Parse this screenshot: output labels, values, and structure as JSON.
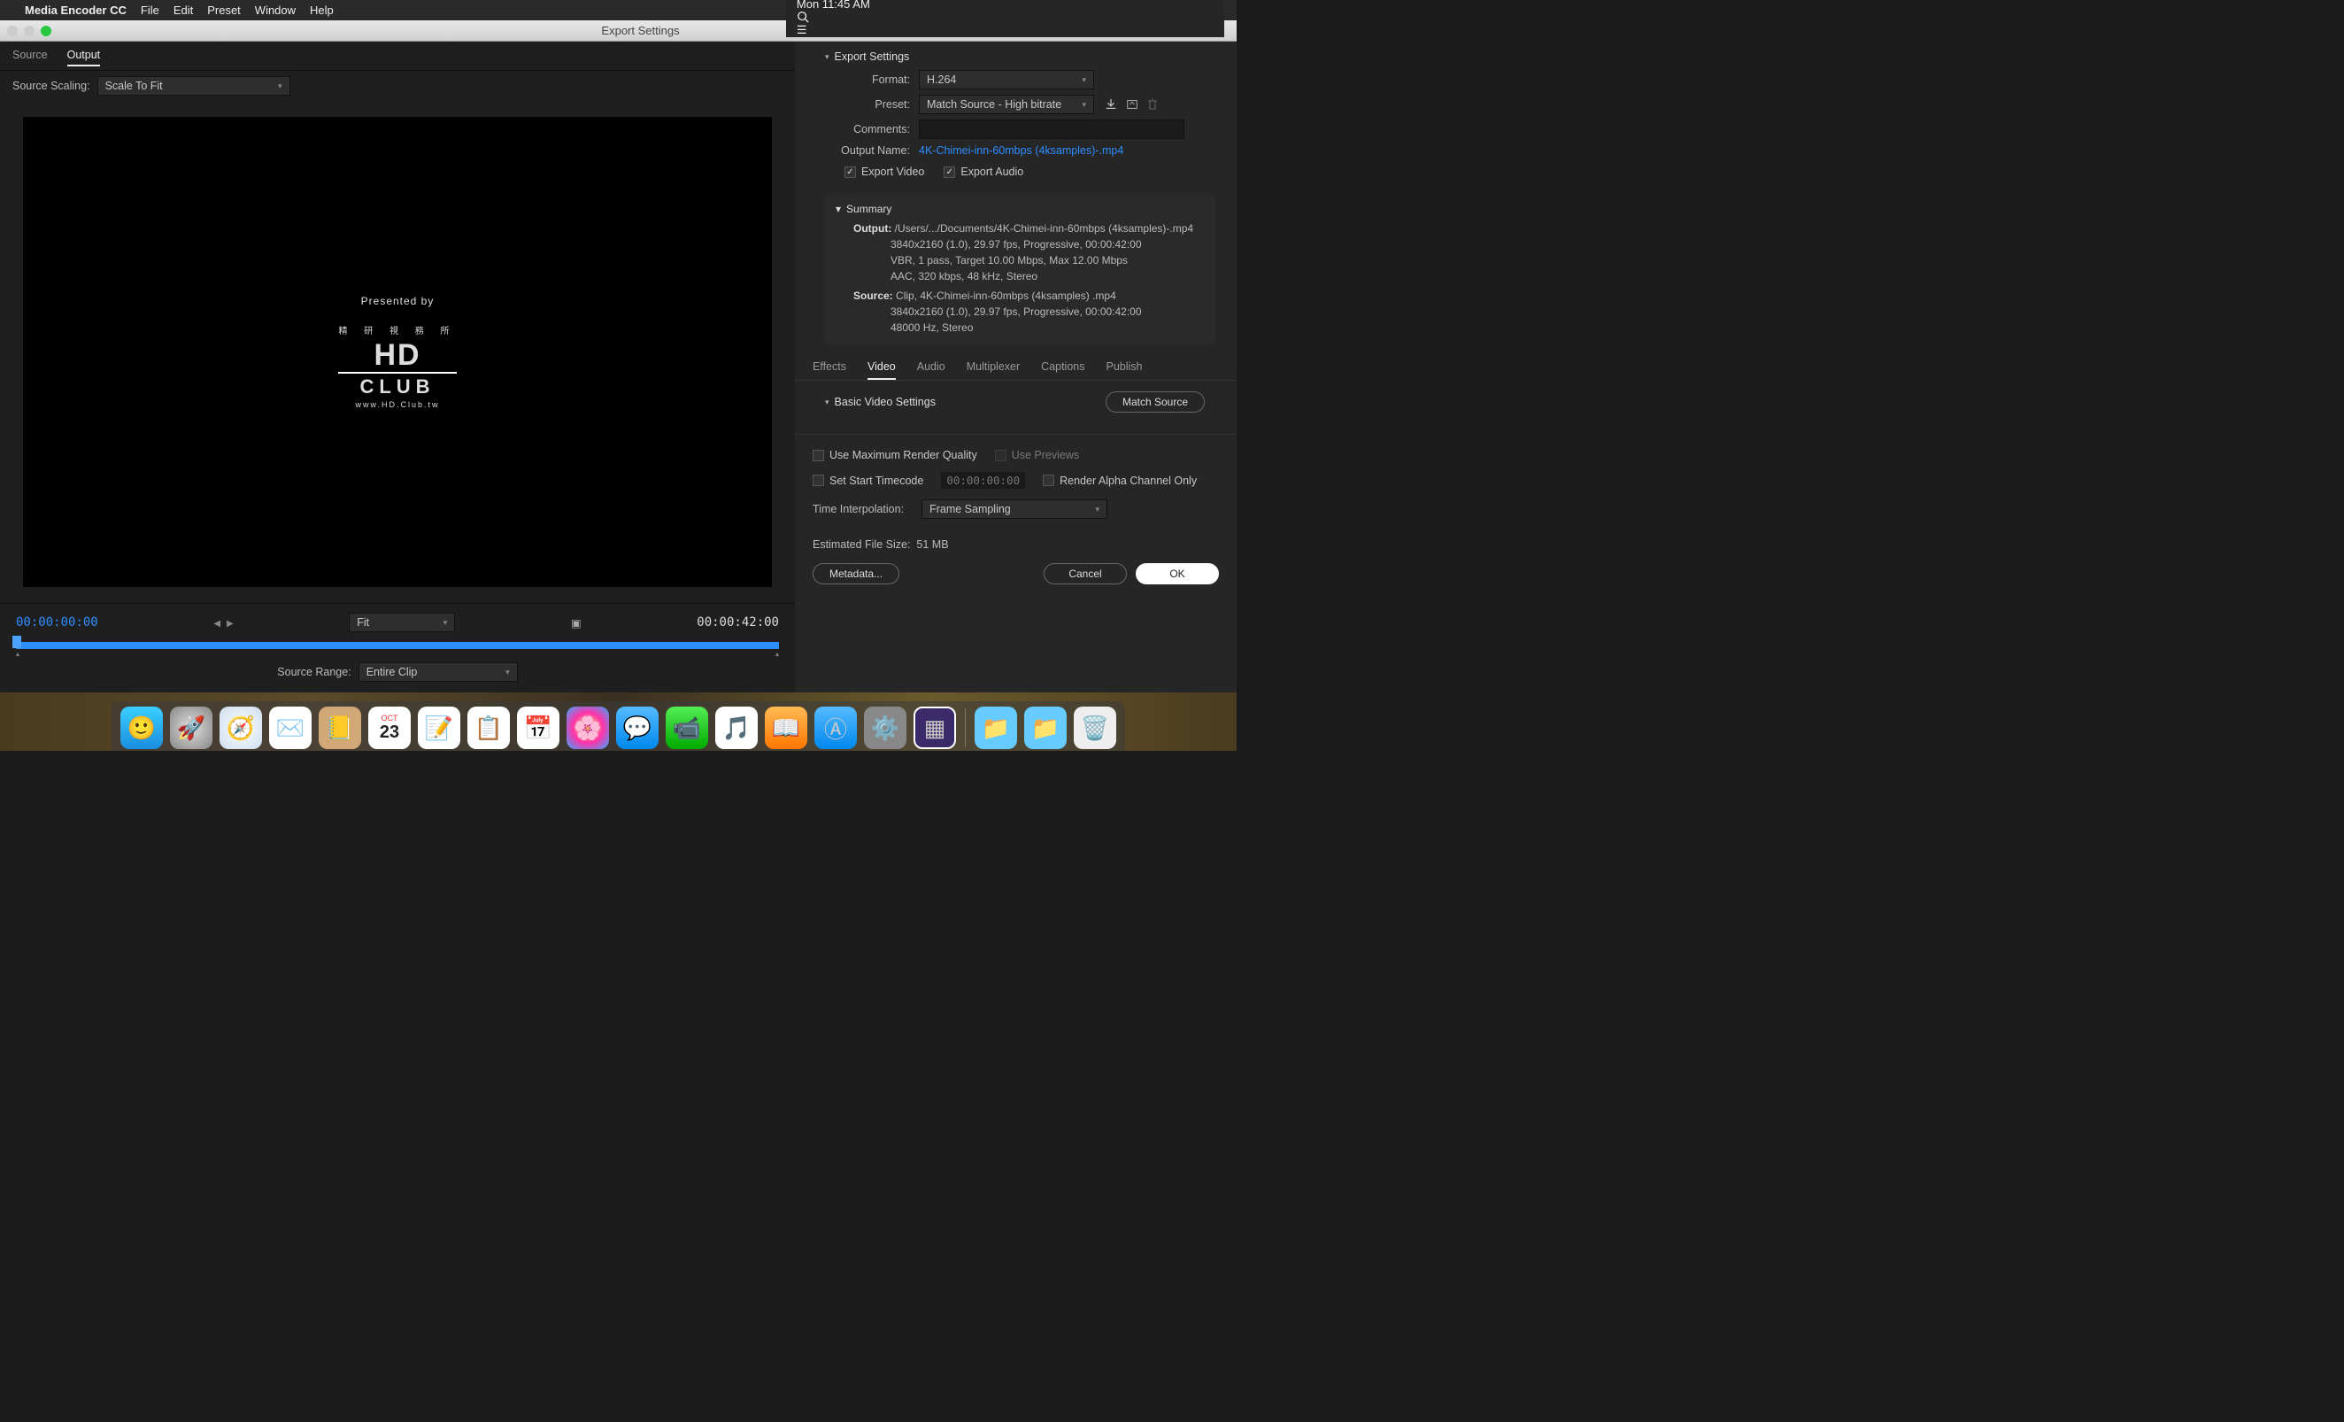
{
  "menubar": {
    "app": "Media Encoder CC",
    "items": [
      "File",
      "Edit",
      "Preset",
      "Window",
      "Help"
    ],
    "clock": "Mon 11:45 AM"
  },
  "window": {
    "title": "Export Settings"
  },
  "left": {
    "tabs": [
      "Source",
      "Output"
    ],
    "active_tab": 1,
    "source_scaling_label": "Source Scaling:",
    "source_scaling_value": "Scale To Fit",
    "preview": {
      "presented_by": "Presented by",
      "chinese": "精 研 視 務 所",
      "hd": "HD",
      "club": "CLUB",
      "url": "www.HD.Club.tw"
    },
    "controls": {
      "start_tc": "00:00:00:00",
      "end_tc": "00:00:42:00",
      "zoom_label": "Fit",
      "source_range_label": "Source Range:",
      "source_range_value": "Entire Clip"
    }
  },
  "right": {
    "export_settings_label": "Export Settings",
    "format_label": "Format:",
    "format_value": "H.264",
    "preset_label": "Preset:",
    "preset_value": "Match Source - High bitrate",
    "comments_label": "Comments:",
    "comments_value": "",
    "output_name_label": "Output Name:",
    "output_name_value": "4K-Chimei-inn-60mbps (4ksamples)-.mp4",
    "export_video_label": "Export Video",
    "export_video": true,
    "export_audio_label": "Export Audio",
    "export_audio": true,
    "summary": {
      "label": "Summary",
      "output_label": "Output:",
      "output_lines": [
        "/Users/.../Documents/4K-Chimei-inn-60mbps (4ksamples)-.mp4",
        "3840x2160 (1.0), 29.97 fps, Progressive, 00:00:42:00",
        "VBR, 1 pass, Target 10.00 Mbps, Max 12.00 Mbps",
        "AAC, 320 kbps, 48 kHz, Stereo"
      ],
      "source_label": "Source:",
      "source_lines": [
        "Clip, 4K-Chimei-inn-60mbps (4ksamples) .mp4",
        "3840x2160 (1.0), 29.97 fps, Progressive, 00:00:42:00",
        "48000 Hz, Stereo"
      ]
    },
    "tabs": [
      "Effects",
      "Video",
      "Audio",
      "Multiplexer",
      "Captions",
      "Publish"
    ],
    "tabs_active": 1,
    "basic_video_label": "Basic Video Settings",
    "match_source_btn": "Match Source",
    "use_max_quality_label": "Use Maximum Render Quality",
    "use_previews_label": "Use Previews",
    "set_start_tc_label": "Set Start Timecode",
    "set_start_tc_value": "00:00:00:00",
    "render_alpha_label": "Render Alpha Channel Only",
    "time_interp_label": "Time Interpolation:",
    "time_interp_value": "Frame Sampling",
    "est_label": "Estimated File Size:",
    "est_value": "51 MB",
    "metadata_btn": "Metadata...",
    "cancel_btn": "Cancel",
    "ok_btn": "OK"
  },
  "dock": {
    "apps": [
      "finder",
      "launchpad",
      "safari",
      "mail",
      "contacts",
      "calendar",
      "notes",
      "reminders",
      "photos-app",
      "photos",
      "messages",
      "facetime",
      "itunes",
      "ibooks",
      "appstore",
      "preferences",
      "media-encoder"
    ],
    "extras": [
      "apps-folder",
      "downloads-folder",
      "trash"
    ]
  }
}
